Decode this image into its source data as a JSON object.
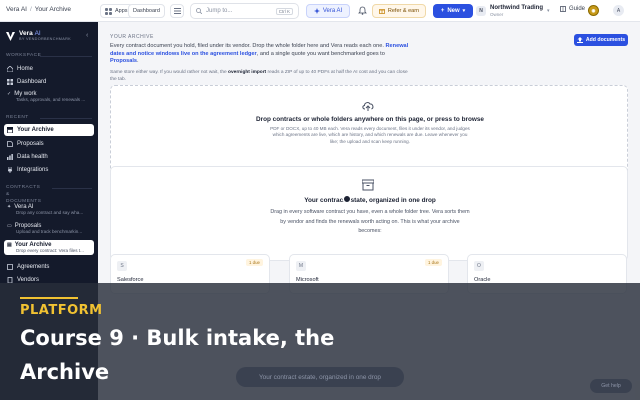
{
  "topbar": {
    "breadcrumb": [
      "Vera AI",
      "Your Archive"
    ],
    "apps_label": "Apps",
    "dashboard_label": "Dashboard",
    "search_placeholder": "Jump to...",
    "search_shortcut": "Ctrl K",
    "vera_label": "Vera AI",
    "refer_label": "Refer & earn",
    "new_label": "New",
    "org_badge": "N",
    "org_name": "Northwind Trading",
    "org_role": "Owner",
    "guide_label": "Guide",
    "avatar_initial": "A",
    "accent_color": "#2b50e0"
  },
  "sidebar": {
    "brand_name": "Vera",
    "brand_ai": "AI",
    "brand_sub": "BY VENDORBENCHMARK",
    "sections": {
      "workspace": "WORKSPACE",
      "recent": "RECENT",
      "contracts": "CONTRACTS & DOCUMENTS"
    },
    "workspace_items": [
      {
        "label": "Home",
        "icon": "home-icon"
      },
      {
        "label": "Dashboard",
        "icon": "dashboard-icon"
      }
    ],
    "my_work": {
      "label": "My work",
      "sub": "Tasks, approvals, and renewals ..."
    },
    "recent_items": [
      {
        "label": "Your Archive",
        "icon": "archive-icon"
      },
      {
        "label": "Proposals",
        "icon": "file-icon"
      },
      {
        "label": "Data health",
        "icon": "chart-icon"
      },
      {
        "label": "Integrations",
        "icon": "plug-icon"
      }
    ],
    "contract_items": [
      {
        "label": "Vera AI",
        "sub": "Drop any contract and say wha..."
      },
      {
        "label": "Proposals",
        "sub": "Upload and track benchmarkin..."
      },
      {
        "label": "Your Archive",
        "sub": "Drop every contract: Vera files t..."
      }
    ],
    "agreements_label": "Agreements",
    "vendors_label": "Vendors"
  },
  "main": {
    "section_label": "YOUR ARCHIVE",
    "intro_a": "Every contract document you hold, filed under its vendor. Drop the whole folder here and Vera reads each one.",
    "intro_link": "Renewal dates and notice windows live on the agreement ledger",
    "intro_b": ", and a single quote you want benchmarked goes to",
    "intro_link2": "Proposals",
    "intro2_a": "Same store either way. If you would rather not wait, the",
    "intro2_b": "overnight import",
    "intro2_c": "reads a ZIP of up to 40 PDFs at half the AI cost and you can close the tab.",
    "add_docs_label": "Add documents",
    "drop_title": "Drop contracts or whole folders anywhere on this page, or press to browse",
    "drop_sub": "PDF or DOCX, up to 40 MB each. Vera reads every document, files it under its vendor, and judges which agreements are live, which are history, and which renewals are due. Leave whenever you like; the upload and scan keep running.",
    "estate_title": "Your contract estate, organized in one drop",
    "estate_sub": "Drag in every software contract you have, even a whole folder tree. Vera sorts them by vendor and finds the renewals worth acting on. This is what your archive becomes:",
    "vendors": [
      {
        "initial": "S",
        "name": "Salesforce",
        "chip": "1 due"
      },
      {
        "initial": "M",
        "name": "Microsoft",
        "chip": "1 due"
      },
      {
        "initial": "O",
        "name": "Oracle",
        "chip": ""
      }
    ]
  },
  "overlay": {
    "tag": "PLATFORM",
    "title": "Course 9 · Bulk intake, the Archive",
    "pill": "Your contract estate, organized in one drop",
    "help": "Get help",
    "tag_color": "#f1c232"
  }
}
